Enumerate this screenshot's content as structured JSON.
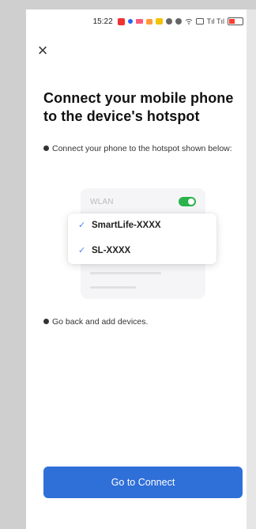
{
  "status_bar": {
    "time": "15:22",
    "signal_text": "Tıl Tıl"
  },
  "header": {
    "close_glyph": "×"
  },
  "main": {
    "title": "Connect your mobile phone to the device's hotspot",
    "step1_text": "Connect your phone to the hotspot shown below:",
    "step2_text": "Go back and add devices."
  },
  "illustration": {
    "wlan_label": "WLAN",
    "networks": [
      {
        "name": "SmartLife-XXXX",
        "check_glyph": "✓"
      },
      {
        "name": "SL-XXXX",
        "check_glyph": "✓"
      }
    ],
    "toggle_on": true,
    "toggle_color": "#2ab34a"
  },
  "footer": {
    "button_label": "Go to Connect",
    "button_color": "#2f6fd8"
  },
  "icons": {
    "status_icons": [
      "app-red-icon",
      "dot-blue-icon",
      "pink-icon",
      "orange-icon",
      "yellow-icon",
      "gear-icon",
      "share-icon",
      "wifi-icon",
      "card-icon",
      "signal-icon",
      "battery-icon"
    ]
  }
}
